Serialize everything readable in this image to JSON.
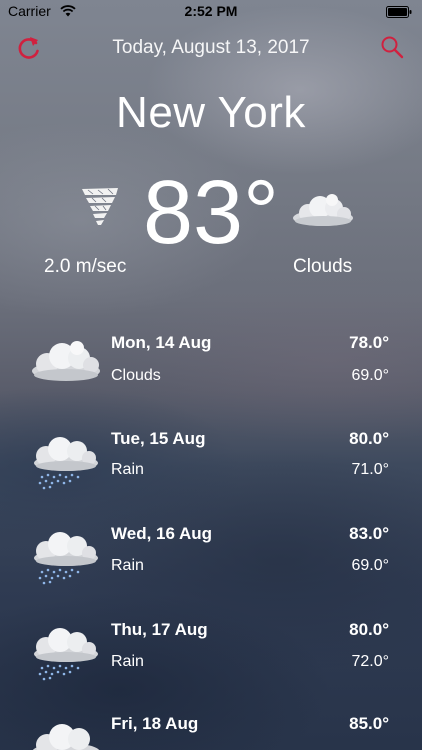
{
  "status_bar": {
    "carrier": "Carrier",
    "time": "2:52 PM"
  },
  "header": {
    "date": "Today, August 13, 2017",
    "city": "New York",
    "refresh_icon": "refresh-icon",
    "search_icon": "search-icon",
    "accent_color": "#d0213f"
  },
  "current": {
    "temperature": "83°",
    "wind_speed": "2.0 m/sec",
    "condition": "Clouds",
    "wind_icon": "tornado-icon",
    "condition_icon": "cloud-icon"
  },
  "forecast": [
    {
      "day": "Mon, 14 Aug",
      "high": "78.0°",
      "condition": "Clouds",
      "low": "69.0°",
      "icon": "cloud-icon"
    },
    {
      "day": "Tue, 15 Aug",
      "high": "80.0°",
      "condition": "Rain",
      "low": "71.0°",
      "icon": "rain-icon"
    },
    {
      "day": "Wed, 16 Aug",
      "high": "83.0°",
      "condition": "Rain",
      "low": "69.0°",
      "icon": "rain-icon"
    },
    {
      "day": "Thu, 17 Aug",
      "high": "80.0°",
      "condition": "Rain",
      "low": "72.0°",
      "icon": "rain-icon"
    },
    {
      "day": "Fri, 18 Aug",
      "high": "85.0°",
      "condition": "",
      "low": "",
      "icon": "cloud-icon"
    }
  ]
}
